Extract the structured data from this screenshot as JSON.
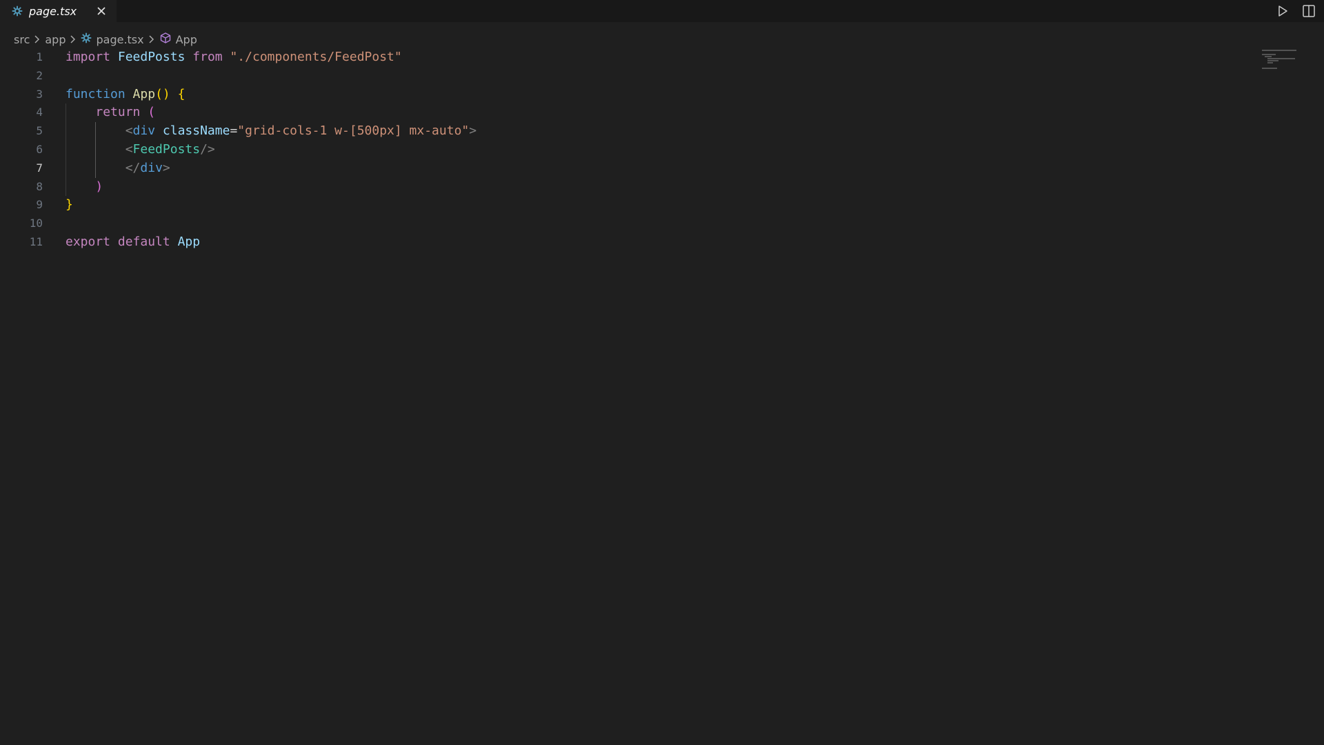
{
  "tab": {
    "filename": "page.tsx",
    "icon": "react-gear-icon",
    "close_icon": "close-icon"
  },
  "actions": {
    "run_icon": "play-icon",
    "split_icon": "split-editor-icon"
  },
  "breadcrumb": {
    "items": [
      "src",
      "app",
      "page.tsx",
      "App"
    ]
  },
  "editor": {
    "active_line": 7,
    "line_numbers": [
      "1",
      "2",
      "3",
      "4",
      "5",
      "6",
      "7",
      "8",
      "9",
      "10",
      "11"
    ],
    "lines": [
      {
        "tokens": [
          {
            "t": "import",
            "c": "kw-purple"
          },
          {
            "t": " ",
            "c": "plain"
          },
          {
            "t": "FeedPosts",
            "c": "ident"
          },
          {
            "t": " ",
            "c": "plain"
          },
          {
            "t": "from",
            "c": "kw-purple"
          },
          {
            "t": " ",
            "c": "plain"
          },
          {
            "t": "\"./components/FeedPost\"",
            "c": "str"
          }
        ]
      },
      {
        "tokens": []
      },
      {
        "tokens": [
          {
            "t": "function",
            "c": "kw-blue"
          },
          {
            "t": " ",
            "c": "plain"
          },
          {
            "t": "App",
            "c": "fn"
          },
          {
            "t": "()",
            "c": "brace"
          },
          {
            "t": " ",
            "c": "plain"
          },
          {
            "t": "{",
            "c": "brace"
          }
        ]
      },
      {
        "tokens": [
          {
            "t": "    ",
            "c": "plain"
          },
          {
            "t": "return",
            "c": "kw-purple"
          },
          {
            "t": " ",
            "c": "plain"
          },
          {
            "t": "(",
            "c": "paren-p"
          }
        ]
      },
      {
        "tokens": [
          {
            "t": "        ",
            "c": "plain"
          },
          {
            "t": "<",
            "c": "tag-punc"
          },
          {
            "t": "div",
            "c": "tag"
          },
          {
            "t": " ",
            "c": "plain"
          },
          {
            "t": "className",
            "c": "attr"
          },
          {
            "t": "=",
            "c": "plain"
          },
          {
            "t": "\"grid-cols-1 w-[500px] mx-auto\"",
            "c": "str"
          },
          {
            "t": ">",
            "c": "tag-punc"
          }
        ]
      },
      {
        "tokens": [
          {
            "t": "        ",
            "c": "plain"
          },
          {
            "t": "<",
            "c": "tag-punc"
          },
          {
            "t": "FeedPosts",
            "c": "comp"
          },
          {
            "t": "/>",
            "c": "tag-punc"
          }
        ]
      },
      {
        "tokens": [
          {
            "t": "        ",
            "c": "plain"
          },
          {
            "t": "</",
            "c": "tag-punc"
          },
          {
            "t": "div",
            "c": "tag"
          },
          {
            "t": ">",
            "c": "tag-punc"
          }
        ]
      },
      {
        "tokens": [
          {
            "t": "    ",
            "c": "plain"
          },
          {
            "t": ")",
            "c": "paren-p"
          }
        ]
      },
      {
        "tokens": [
          {
            "t": "}",
            "c": "brace"
          }
        ]
      },
      {
        "tokens": []
      },
      {
        "tokens": [
          {
            "t": "export",
            "c": "kw-purple"
          },
          {
            "t": " ",
            "c": "plain"
          },
          {
            "t": "default",
            "c": "kw-purple"
          },
          {
            "t": " ",
            "c": "plain"
          },
          {
            "t": "App",
            "c": "ident"
          }
        ]
      }
    ]
  },
  "colors": {
    "background": "#1f1f1f",
    "tabbar": "#181818",
    "react_icon": "#519aba"
  }
}
